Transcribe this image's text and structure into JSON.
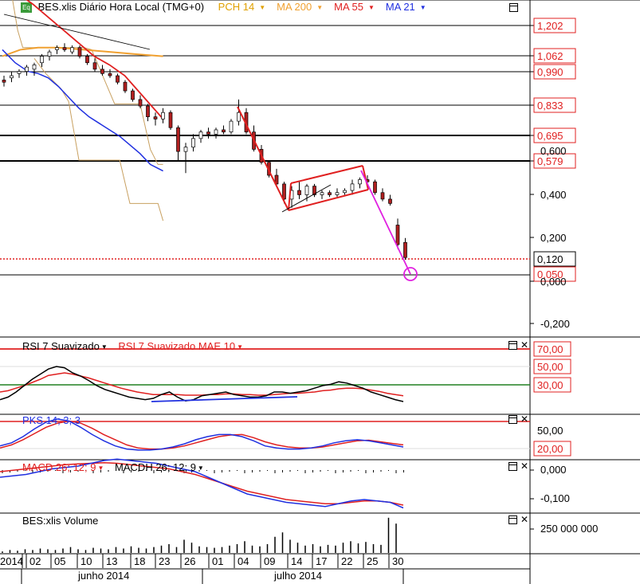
{
  "header": {
    "title": "BES.xlis Diário Hora Local (TMG+0)",
    "indicators": [
      {
        "label": "PCH 14",
        "color": "#e0a000"
      },
      {
        "label": "MA 200",
        "color": "#f0a030"
      },
      {
        "label": "MA 55",
        "color": "#e02020"
      },
      {
        "label": "MA 21",
        "color": "#2030e0"
      }
    ],
    "eq_icon": "Eq"
  },
  "price_panel": {
    "level_labels": [
      "1,202",
      "1,062",
      "0,990",
      "0,833",
      "0,695",
      "0,579",
      "0,120",
      "0,050"
    ],
    "axis_labels": [
      "0,400",
      "0,200",
      "0,000",
      "-0,200"
    ],
    "partial_axis_label": "0,600"
  },
  "rsi_panel": {
    "title": "RSI 7 Suavizado",
    "title2": "RSI 7 Suavizado MAE 10",
    "levels": [
      "70,00",
      "50,00",
      "30,00"
    ]
  },
  "pks_panel": {
    "title": "PKS 14; 3; 3",
    "levels": [
      "50,00",
      "20,00"
    ]
  },
  "macd_panel": {
    "title": "MACD 26; 12; 9",
    "title2": "MACDH 26; 12; 9",
    "levels": [
      "0,000",
      "-0,100"
    ]
  },
  "volume_panel": {
    "title": "BES:xlis Volume",
    "level": "250 000 000"
  },
  "x_axis": {
    "day_labels": [
      "2014",
      "02",
      "05",
      "10",
      "13",
      "18",
      "23",
      "26",
      "01",
      "04",
      "09",
      "14",
      "17",
      "22",
      "25",
      "30"
    ],
    "month_labels": [
      "junho 2014",
      "julho 2014"
    ]
  },
  "chart_data": {
    "type": "candlestick",
    "candles": [
      {
        "o": 0.95,
        "h": 0.97,
        "l": 0.92,
        "c": 0.94
      },
      {
        "o": 0.96,
        "h": 0.99,
        "l": 0.94,
        "c": 0.97
      },
      {
        "o": 0.98,
        "h": 1.0,
        "l": 0.96,
        "c": 0.99
      },
      {
        "o": 0.99,
        "h": 1.02,
        "l": 0.97,
        "c": 1.01
      },
      {
        "o": 1.0,
        "h": 1.03,
        "l": 0.97,
        "c": 1.02
      },
      {
        "o": 1.03,
        "h": 1.07,
        "l": 1.01,
        "c": 1.06
      },
      {
        "o": 1.06,
        "h": 1.09,
        "l": 1.04,
        "c": 1.08
      },
      {
        "o": 1.09,
        "h": 1.11,
        "l": 1.07,
        "c": 1.1
      },
      {
        "o": 1.1,
        "h": 1.12,
        "l": 1.08,
        "c": 1.09
      },
      {
        "o": 1.08,
        "h": 1.11,
        "l": 1.07,
        "c": 1.1
      },
      {
        "o": 1.1,
        "h": 1.11,
        "l": 1.05,
        "c": 1.06
      },
      {
        "o": 1.06,
        "h": 1.07,
        "l": 1.02,
        "c": 1.03
      },
      {
        "o": 1.03,
        "h": 1.05,
        "l": 0.99,
        "c": 1.0
      },
      {
        "o": 1.0,
        "h": 1.02,
        "l": 0.97,
        "c": 0.98
      },
      {
        "o": 0.98,
        "h": 1.0,
        "l": 0.96,
        "c": 0.97
      },
      {
        "o": 0.97,
        "h": 0.98,
        "l": 0.93,
        "c": 0.94
      },
      {
        "o": 0.94,
        "h": 0.95,
        "l": 0.89,
        "c": 0.9
      },
      {
        "o": 0.9,
        "h": 0.91,
        "l": 0.85,
        "c": 0.86
      },
      {
        "o": 0.86,
        "h": 0.88,
        "l": 0.82,
        "c": 0.83
      },
      {
        "o": 0.83,
        "h": 0.84,
        "l": 0.76,
        "c": 0.78
      },
      {
        "o": 0.78,
        "h": 0.8,
        "l": 0.74,
        "c": 0.77
      },
      {
        "o": 0.77,
        "h": 0.82,
        "l": 0.75,
        "c": 0.8
      },
      {
        "o": 0.8,
        "h": 0.81,
        "l": 0.72,
        "c": 0.73
      },
      {
        "o": 0.73,
        "h": 0.74,
        "l": 0.58,
        "c": 0.62
      },
      {
        "o": 0.62,
        "h": 0.66,
        "l": 0.52,
        "c": 0.64
      },
      {
        "o": 0.64,
        "h": 0.7,
        "l": 0.62,
        "c": 0.68
      },
      {
        "o": 0.68,
        "h": 0.72,
        "l": 0.66,
        "c": 0.71
      },
      {
        "o": 0.71,
        "h": 0.73,
        "l": 0.68,
        "c": 0.7
      },
      {
        "o": 0.7,
        "h": 0.73,
        "l": 0.68,
        "c": 0.72
      },
      {
        "o": 0.72,
        "h": 0.74,
        "l": 0.7,
        "c": 0.71
      },
      {
        "o": 0.71,
        "h": 0.77,
        "l": 0.7,
        "c": 0.76
      },
      {
        "o": 0.76,
        "h": 0.86,
        "l": 0.74,
        "c": 0.8
      },
      {
        "o": 0.8,
        "h": 0.82,
        "l": 0.7,
        "c": 0.71
      },
      {
        "o": 0.71,
        "h": 0.74,
        "l": 0.62,
        "c": 0.63
      },
      {
        "o": 0.63,
        "h": 0.65,
        "l": 0.56,
        "c": 0.57
      },
      {
        "o": 0.57,
        "h": 0.58,
        "l": 0.5,
        "c": 0.51
      },
      {
        "o": 0.51,
        "h": 0.54,
        "l": 0.46,
        "c": 0.47
      },
      {
        "o": 0.47,
        "h": 0.48,
        "l": 0.38,
        "c": 0.4
      },
      {
        "o": 0.4,
        "h": 0.46,
        "l": 0.36,
        "c": 0.44
      },
      {
        "o": 0.44,
        "h": 0.48,
        "l": 0.4,
        "c": 0.42
      },
      {
        "o": 0.42,
        "h": 0.47,
        "l": 0.39,
        "c": 0.46
      },
      {
        "o": 0.46,
        "h": 0.47,
        "l": 0.41,
        "c": 0.42
      },
      {
        "o": 0.42,
        "h": 0.44,
        "l": 0.4,
        "c": 0.43
      },
      {
        "o": 0.43,
        "h": 0.44,
        "l": 0.41,
        "c": 0.42
      },
      {
        "o": 0.42,
        "h": 0.45,
        "l": 0.41,
        "c": 0.43
      },
      {
        "o": 0.43,
        "h": 0.45,
        "l": 0.42,
        "c": 0.44
      },
      {
        "o": 0.44,
        "h": 0.49,
        "l": 0.42,
        "c": 0.47
      },
      {
        "o": 0.47,
        "h": 0.5,
        "l": 0.45,
        "c": 0.49
      },
      {
        "o": 0.49,
        "h": 0.51,
        "l": 0.46,
        "c": 0.48
      },
      {
        "o": 0.48,
        "h": 0.49,
        "l": 0.42,
        "c": 0.43
      },
      {
        "o": 0.43,
        "h": 0.45,
        "l": 0.39,
        "c": 0.4
      },
      {
        "o": 0.4,
        "h": 0.42,
        "l": 0.37,
        "c": 0.38
      },
      {
        "o": 0.28,
        "h": 0.31,
        "l": 0.17,
        "c": 0.19
      },
      {
        "o": 0.2,
        "h": 0.22,
        "l": 0.12,
        "c": 0.13
      }
    ],
    "ma21": [
      [
        0,
        1.09
      ],
      [
        10,
        1.03
      ],
      [
        20,
        0.99
      ],
      [
        28,
        0.98
      ],
      [
        36,
        0.96
      ],
      [
        44,
        0.92
      ],
      [
        52,
        0.87
      ],
      [
        60,
        0.82
      ],
      [
        68,
        0.78
      ],
      [
        76,
        0.75
      ],
      [
        84,
        0.72
      ],
      [
        92,
        0.69
      ],
      [
        100,
        0.65
      ],
      [
        108,
        0.61
      ],
      [
        116,
        0.56
      ],
      [
        126,
        0.53
      ]
    ],
    "ma55": [
      [
        0,
        1.4
      ],
      [
        12,
        1.35
      ],
      [
        24,
        1.3
      ],
      [
        36,
        1.24
      ],
      [
        48,
        1.18
      ],
      [
        60,
        1.12
      ],
      [
        72,
        1.06
      ],
      [
        84,
        1.02
      ],
      [
        96,
        0.97
      ],
      [
        108,
        0.89
      ],
      [
        120,
        0.81
      ],
      [
        126,
        0.77
      ]
    ],
    "ma200": [
      [
        0,
        1.06
      ],
      [
        14,
        1.09
      ],
      [
        28,
        1.1
      ],
      [
        44,
        1.1
      ],
      [
        64,
        1.09
      ],
      [
        84,
        1.08
      ],
      [
        104,
        1.07
      ],
      [
        126,
        1.06
      ]
    ],
    "pch_upper": [
      [
        0,
        1.4
      ],
      [
        8,
        1.32
      ],
      [
        12,
        1.18
      ],
      [
        16,
        1.1
      ],
      [
        64,
        1.1
      ],
      [
        70,
        1.09
      ],
      [
        88,
        0.84
      ],
      [
        108,
        0.84
      ],
      [
        116,
        0.63
      ],
      [
        122,
        0.56
      ],
      [
        126,
        0.56
      ]
    ],
    "pch_lower": [
      [
        25,
        1.05
      ],
      [
        34,
        0.98
      ],
      [
        46,
        0.91
      ],
      [
        52,
        0.85
      ],
      [
        60,
        0.58
      ],
      [
        92,
        0.58
      ],
      [
        100,
        0.38
      ],
      [
        122,
        0.38
      ],
      [
        126,
        0.3
      ]
    ],
    "red_trend": [
      [
        74,
        0.88
      ],
      [
        87,
        0.38
      ]
    ],
    "magenta_trend": [
      [
        112,
        0.64
      ],
      [
        128,
        -0.01
      ]
    ],
    "channel_upper": [
      [
        90,
        0.5
      ],
      [
        112,
        0.56
      ]
    ],
    "channel_lower": [
      [
        90,
        0.38
      ],
      [
        115,
        0.45
      ]
    ],
    "rsi": [
      18,
      22,
      30,
      40,
      50,
      58,
      66,
      70,
      68,
      60,
      55,
      48,
      40,
      34,
      30,
      26,
      22,
      20,
      18,
      20,
      26,
      30,
      22,
      16,
      18,
      24,
      26,
      28,
      30,
      26,
      24,
      22,
      22,
      24,
      30,
      30,
      28,
      30,
      32,
      36,
      40,
      42,
      46,
      44,
      40,
      36,
      30,
      26,
      22,
      18,
      15
    ],
    "rsi_mae": [
      30,
      32,
      36,
      40,
      45,
      50,
      56,
      58,
      60,
      58,
      55,
      52,
      48,
      44,
      40,
      36,
      33,
      30,
      28,
      26,
      26,
      26,
      26,
      25,
      25,
      25,
      26,
      26,
      27,
      27,
      26,
      26,
      25,
      25,
      26,
      27,
      28,
      28,
      29,
      30,
      32,
      33,
      35,
      36,
      36,
      35,
      33,
      31,
      28,
      26,
      24
    ],
    "pks": [
      22,
      28,
      40,
      55,
      68,
      74,
      70,
      58,
      44,
      32,
      22,
      16,
      14,
      14,
      16,
      20,
      26,
      34,
      40,
      44,
      44,
      40,
      32,
      22,
      18,
      16,
      16,
      18,
      22,
      28,
      32,
      34,
      32,
      28,
      24,
      20
    ],
    "pks_sig": [
      18,
      24,
      34,
      46,
      58,
      66,
      70,
      66,
      56,
      44,
      34,
      24,
      18,
      16,
      16,
      18,
      22,
      28,
      34,
      40,
      43,
      44,
      38,
      30,
      24,
      20,
      18,
      18,
      20,
      24,
      28,
      32,
      33,
      30,
      27,
      24
    ],
    "macd": [
      -0.02,
      -0.015,
      -0.01,
      0.0,
      0.01,
      0.015,
      0.02,
      0.03,
      0.04,
      0.045,
      0.04,
      0.035,
      0.03,
      0.02,
      0.01,
      0.0,
      -0.02,
      -0.04,
      -0.06,
      -0.08,
      -0.09,
      -0.1,
      -0.11,
      -0.115,
      -0.12,
      -0.125,
      -0.115,
      -0.105,
      -0.1,
      -0.105,
      -0.11,
      -0.13
    ],
    "macd_sig": [
      0.0,
      0.005,
      0.01,
      0.015,
      0.02,
      0.025,
      0.028,
      0.03,
      0.032,
      0.03,
      0.025,
      0.02,
      0.015,
      0.01,
      0.0,
      -0.01,
      -0.025,
      -0.04,
      -0.055,
      -0.07,
      -0.08,
      -0.09,
      -0.1,
      -0.105,
      -0.11,
      -0.115,
      -0.115,
      -0.11,
      -0.105,
      -0.105,
      -0.11,
      -0.12
    ],
    "volume": [
      2,
      4,
      3,
      5,
      4,
      6,
      5,
      4,
      6,
      8,
      5,
      4,
      7,
      6,
      5,
      8,
      6,
      9,
      7,
      6,
      8,
      10,
      12,
      8,
      18,
      14,
      9,
      8,
      7,
      8,
      10,
      12,
      16,
      10,
      9,
      12,
      22,
      28,
      18,
      14,
      10,
      12,
      9,
      11,
      10,
      14,
      16,
      13,
      15,
      12,
      11,
      48,
      40
    ],
    "volume_unit_max": 50
  }
}
